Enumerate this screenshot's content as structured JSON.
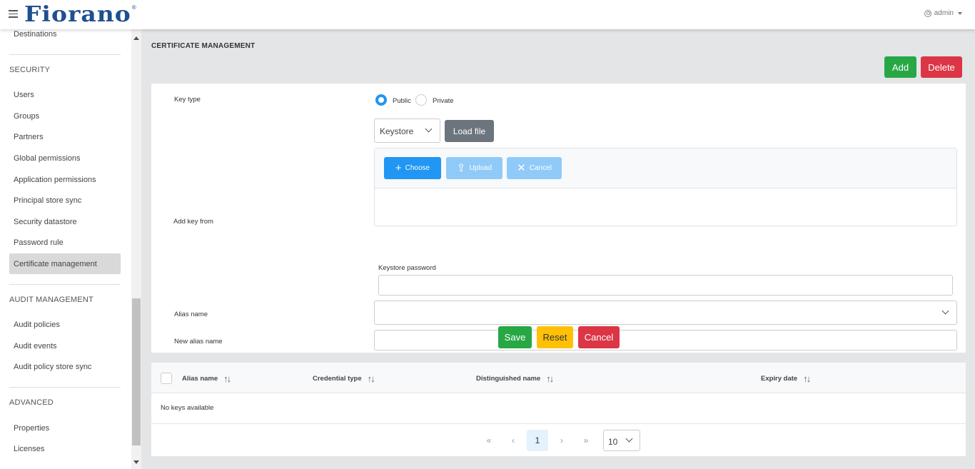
{
  "header": {
    "logo_text": "Fiorano",
    "logo_mark": "®",
    "user": "admin"
  },
  "sidebar": {
    "top_item": "Destinations",
    "sections": [
      {
        "title": "SECURITY",
        "items": [
          "Users",
          "Groups",
          "Partners",
          "Global permissions",
          "Application permissions",
          "Principal store sync",
          "Security datastore",
          "Password rule",
          "Certificate management"
        ]
      },
      {
        "title": "AUDIT MANAGEMENT",
        "items": [
          "Audit policies",
          "Audit events",
          "Audit policy store sync"
        ]
      },
      {
        "title": "ADVANCED",
        "items": [
          "Properties",
          "Licenses"
        ]
      }
    ],
    "active_item": "Certificate management"
  },
  "main": {
    "title": "CERTIFICATE MANAGEMENT",
    "add_label": "Add",
    "delete_label": "Delete"
  },
  "form": {
    "key_type_label": "Key type",
    "key_type_options": [
      "Public",
      "Private"
    ],
    "key_type_selected": "Public",
    "add_key_from_label": "Add key from",
    "source_value": "Keystore",
    "load_file_label": "Load file",
    "upload": {
      "choose_label": "Choose",
      "upload_label": "Upload",
      "cancel_label": "Cancel"
    },
    "keystore_password_label": "Keystore password",
    "keystore_password_value": "",
    "alias_name_label": "Alias name",
    "alias_name_value": "",
    "new_alias_name_label": "New alias name",
    "new_alias_name_value": "",
    "save_label": "Save",
    "reset_label": "Reset",
    "cancel_label": "Cancel"
  },
  "table": {
    "columns": [
      "Alias name",
      "Credential type",
      "Distinguished name",
      "Expiry date"
    ],
    "empty_message": "No keys available",
    "pagination": {
      "first": "«",
      "prev": "‹",
      "current_page": "1",
      "next": "›",
      "last": "»",
      "rows_per_page": "10"
    }
  },
  "colors": {
    "brand": "#1f4f8f",
    "success": "#28a745",
    "danger": "#dc3545",
    "warning": "#ffc107",
    "primary": "#2196f3",
    "primary_light": "#90caf9",
    "secondary": "#6c757d"
  }
}
